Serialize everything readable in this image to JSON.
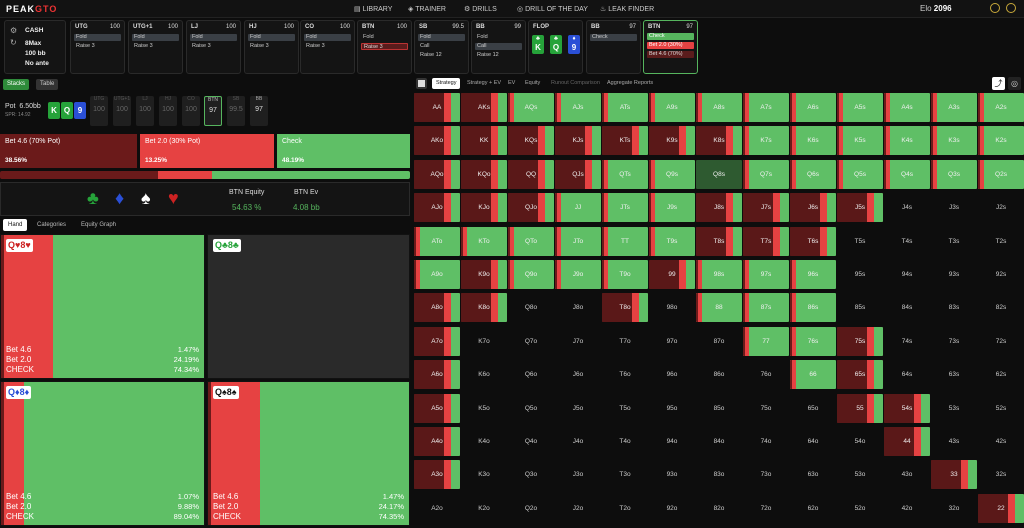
{
  "header": {
    "logo_a": "PEAK",
    "logo_b": "GTO",
    "nav": [
      "LIBRARY",
      "TRAINER",
      "DRILLS",
      "DRILL OF THE DAY",
      "LEAK FINDER"
    ],
    "elo_label": "Elo",
    "elo_value": "2096"
  },
  "config": {
    "game": "CASH",
    "players": "8Max",
    "stack": "100 bb",
    "ante": "No ante"
  },
  "positions": [
    {
      "name": "UTG",
      "stack": "100",
      "actions": [
        "Fold",
        "Raise 3"
      ]
    },
    {
      "name": "UTG+1",
      "stack": "100",
      "actions": [
        "Fold",
        "Raise 3"
      ]
    },
    {
      "name": "LJ",
      "stack": "100",
      "actions": [
        "Fold",
        "Raise 3"
      ]
    },
    {
      "name": "HJ",
      "stack": "100",
      "actions": [
        "Fold",
        "Raise 3"
      ]
    },
    {
      "name": "CO",
      "stack": "100",
      "actions": [
        "Fold",
        "Raise 3"
      ]
    },
    {
      "name": "BTN",
      "stack": "100",
      "actions": [
        "Fold",
        "Raise 3"
      ]
    },
    {
      "name": "SB",
      "stack": "99.5",
      "actions": [
        "Fold",
        "Call",
        "Raise 12"
      ]
    },
    {
      "name": "BB",
      "stack": "99",
      "actions": [
        "Fold",
        "Call",
        "Raise 12"
      ]
    },
    {
      "name": "FLOP",
      "stack": "",
      "actions": []
    },
    {
      "name": "BB",
      "stack": "97",
      "actions": [
        "Check"
      ]
    },
    {
      "name": "BTN",
      "stack": "97",
      "actions": [
        "Check",
        "Bet 2.0 (30%)",
        "Bet 4.6 (70%)"
      ]
    }
  ],
  "flop_cards": [
    {
      "rank": "K",
      "suit": "♣",
      "color": "#26a33a"
    },
    {
      "rank": "Q",
      "suit": "♣",
      "color": "#26a33a"
    },
    {
      "rank": "9",
      "suit": "♦",
      "color": "#2a4fd6"
    }
  ],
  "left_tabs": [
    "Stacks",
    "Table"
  ],
  "pot": {
    "label": "Pot",
    "value": "6.50bb",
    "spr": "SPR: 14.92"
  },
  "pot_positions": [
    {
      "name": "UTG",
      "v": "100"
    },
    {
      "name": "UTG+1",
      "v": "100"
    },
    {
      "name": "LJ",
      "v": "100"
    },
    {
      "name": "HJ",
      "v": "100"
    },
    {
      "name": "CO",
      "v": "100"
    },
    {
      "name": "BTN",
      "v": "97"
    },
    {
      "name": "SB",
      "v": "99.5"
    },
    {
      "name": "BB",
      "v": "97"
    }
  ],
  "strategy": [
    {
      "label": "Bet 4.6 (70% Pot)",
      "pct": "38.56%"
    },
    {
      "label": "Bet 2.0 (30% Pot)",
      "pct": "13.25%"
    },
    {
      "label": "Check",
      "pct": "48.19%"
    }
  ],
  "equity": {
    "k1": "BTN Equity",
    "v1": "54.63 %",
    "k2": "BTN Ev",
    "v2": "4.08 bb"
  },
  "hand_tabs": [
    "Hand",
    "Categories",
    "Equity Graph"
  ],
  "hands": [
    {
      "card": "Q♥8♥",
      "labels": [
        "Bet 4.6",
        "Bet 2.0",
        "CHECK"
      ],
      "pcts": [
        "1.47%",
        "24.19%",
        "74.34%"
      ]
    },
    {
      "card": "Q♣8♣",
      "labels": [],
      "pcts": []
    },
    {
      "card": "Q♦8♦",
      "labels": [
        "Bet 4.6",
        "Bet 2.0",
        "CHECK"
      ],
      "pcts": [
        "1.07%",
        "9.88%",
        "89.04%"
      ]
    },
    {
      "card": "Q♠8♠",
      "labels": [
        "Bet 4.6",
        "Bet 2.0",
        "CHECK"
      ],
      "pcts": [
        "1.47%",
        "24.17%",
        "74.35%"
      ]
    }
  ],
  "right_tabs": [
    "Strategy",
    "Strategy + EV",
    "EV",
    "Equity",
    "Runout Comparison",
    "Aggregate Reports"
  ],
  "ranks": [
    "A",
    "K",
    "Q",
    "J",
    "T",
    "9",
    "8",
    "7",
    "6",
    "5",
    "4",
    "3",
    "2"
  ]
}
